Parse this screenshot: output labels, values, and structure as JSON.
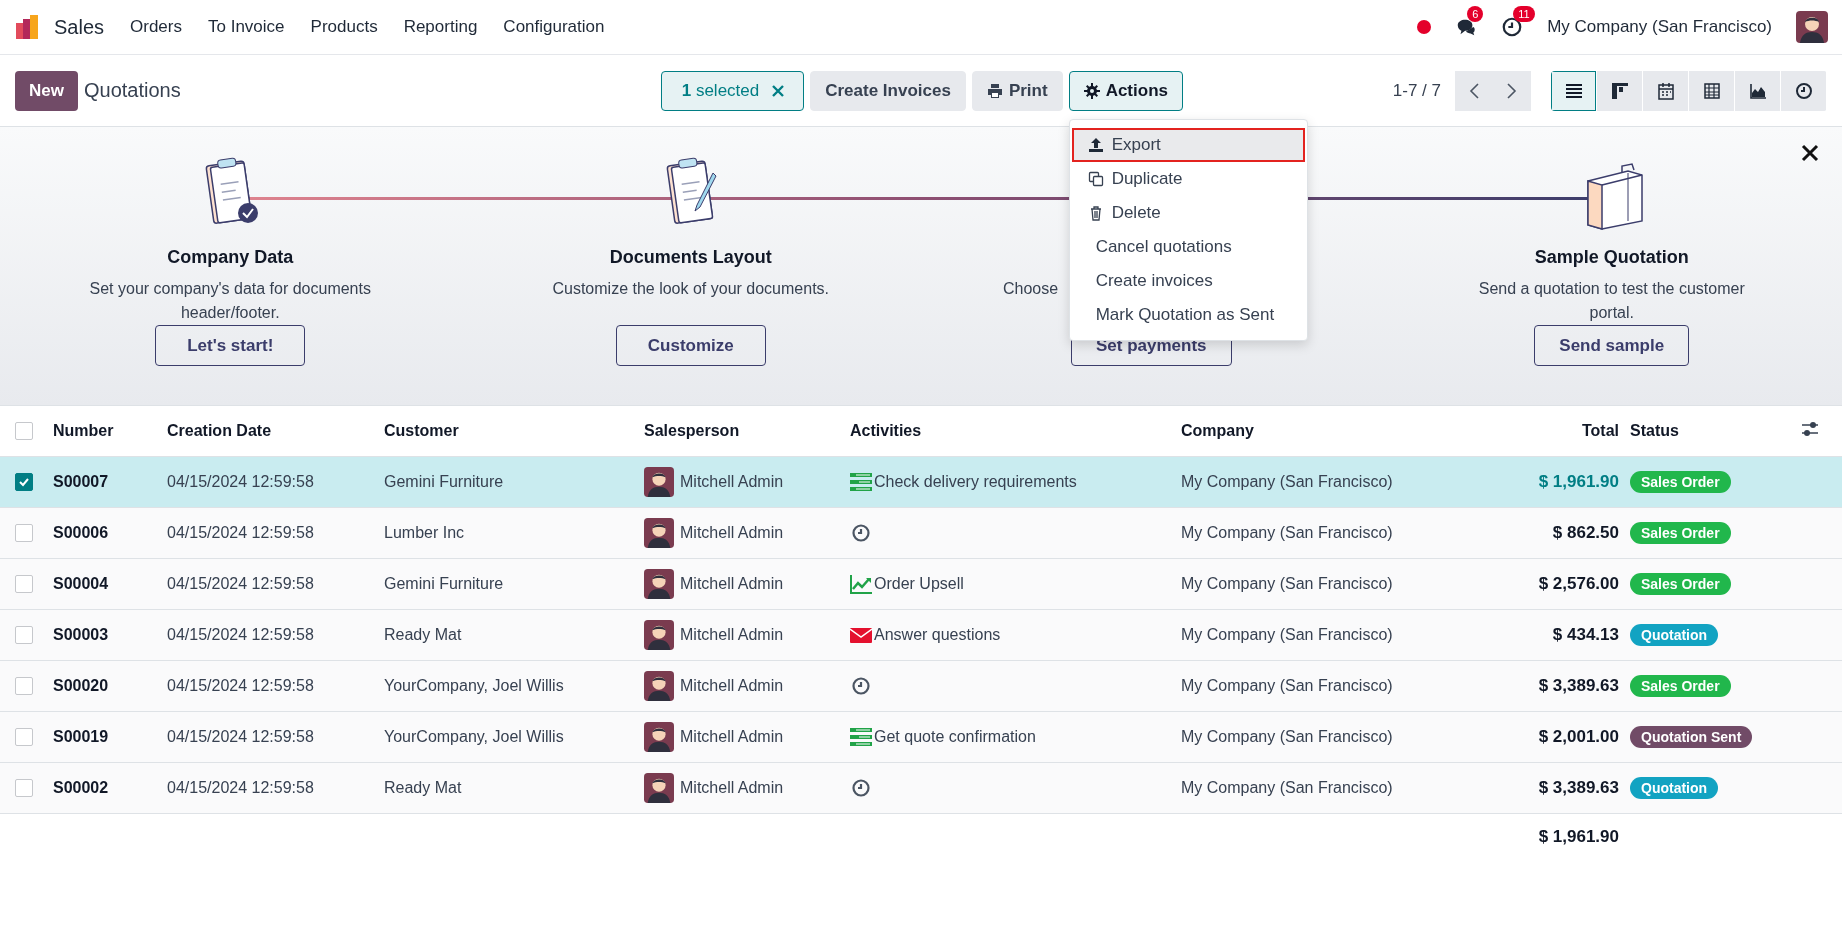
{
  "navbar": {
    "app": "Sales",
    "menu": [
      "Orders",
      "To Invoice",
      "Products",
      "Reporting",
      "Configuration"
    ],
    "messages_badge": "6",
    "activities_badge": "11",
    "company": "My Company (San Francisco)"
  },
  "control_panel": {
    "new_button": "New",
    "title": "Quotations",
    "selection": "**1** selected",
    "buttons": [
      {
        "label": "Create Invoices",
        "kind": "plain",
        "open": false
      },
      {
        "label": "Print",
        "kind": "print",
        "open": false
      },
      {
        "label": "Actions",
        "kind": "gear",
        "open": true
      }
    ],
    "pager": "1-7 / 7",
    "views": [
      {
        "kind": "list",
        "selected": true
      },
      {
        "kind": "kanban",
        "selected": false
      },
      {
        "kind": "calendar",
        "selected": false
      },
      {
        "kind": "pivot",
        "selected": false
      },
      {
        "kind": "graph",
        "selected": false
      },
      {
        "kind": "activity",
        "selected": false
      }
    ]
  },
  "actions_menu": [
    {
      "label": "Export",
      "kind": "upload",
      "highlighted": true,
      "marked": true
    },
    {
      "label": "Duplicate",
      "kind": "copy",
      "highlighted": false,
      "marked": false
    },
    {
      "label": "Delete",
      "kind": "trash",
      "highlighted": false,
      "marked": false
    },
    {
      "label": "Cancel quotations",
      "kind": "text",
      "highlighted": false,
      "marked": false
    },
    {
      "label": "Create invoices",
      "kind": "text",
      "highlighted": false,
      "marked": false
    },
    {
      "label": "Mark Quotation as Sent",
      "kind": "text",
      "highlighted": false,
      "marked": false
    }
  ],
  "onboarding": {
    "steps": [
      {
        "kind": "data",
        "title": "Company Data",
        "description": "Set your company's data for documents header/footer.",
        "button": "Let's start!",
        "covered": false
      },
      {
        "kind": "layout",
        "title": "Documents Layout",
        "description": "Customize the look of your documents.",
        "button": "Customize",
        "covered": false
      },
      {
        "kind": "payment",
        "description": "Choose",
        "button": "Set payments",
        "covered": true
      },
      {
        "kind": "sample",
        "title": "Sample Quotation",
        "description": "Send a quotation to test the customer portal.",
        "button": "Send sample",
        "covered": false
      }
    ]
  },
  "table": {
    "select_all": false,
    "columns": [
      "Number",
      "Creation Date",
      "Customer",
      "Salesperson",
      "Activities",
      "Company",
      "Total",
      "Status"
    ],
    "rows": [
      {
        "selected": true,
        "number": "S00007",
        "date": "04/15/2024 12:59:58",
        "customer": "Gemini Furniture",
        "salesperson": "Mitchell Admin",
        "activity": {
          "kind": "todo",
          "label": "Check delivery requirements"
        },
        "company": "My Company (San Francisco)",
        "total": "$ 1,961.90",
        "status": {
          "label": "Sales Order",
          "color": "#21b74c"
        }
      },
      {
        "selected": false,
        "number": "S00006",
        "date": "04/15/2024 12:59:58",
        "customer": "Lumber Inc",
        "salesperson": "Mitchell Admin",
        "activity": {
          "kind": "none"
        },
        "company": "My Company (San Francisco)",
        "total": "$ 862.50",
        "status": {
          "label": "Sales Order",
          "color": "#21b74c"
        }
      },
      {
        "selected": false,
        "number": "S00004",
        "date": "04/15/2024 12:59:58",
        "customer": "Gemini Furniture",
        "salesperson": "Mitchell Admin",
        "activity": {
          "kind": "upsell",
          "label": "Order Upsell"
        },
        "company": "My Company (San Francisco)",
        "total": "$ 2,576.00",
        "status": {
          "label": "Sales Order",
          "color": "#21b74c"
        }
      },
      {
        "selected": false,
        "number": "S00003",
        "date": "04/15/2024 12:59:58",
        "customer": "Ready Mat",
        "salesperson": "Mitchell Admin",
        "activity": {
          "kind": "email",
          "label": "Answer questions"
        },
        "company": "My Company (San Francisco)",
        "total": "$ 434.13",
        "status": {
          "label": "Quotation",
          "color": "#12a3c2"
        }
      },
      {
        "selected": false,
        "number": "S00020",
        "date": "04/15/2024 12:59:58",
        "customer": "YourCompany, Joel Willis",
        "salesperson": "Mitchell Admin",
        "activity": {
          "kind": "none"
        },
        "company": "My Company (San Francisco)",
        "total": "$ 3,389.63",
        "status": {
          "label": "Sales Order",
          "color": "#21b74c"
        }
      },
      {
        "selected": false,
        "number": "S00019",
        "date": "04/15/2024 12:59:58",
        "customer": "YourCompany, Joel Willis",
        "salesperson": "Mitchell Admin",
        "activity": {
          "kind": "todo",
          "label": "Get quote confirmation"
        },
        "company": "My Company (San Francisco)",
        "total": "$ 2,001.00",
        "status": {
          "label": "Quotation Sent",
          "color": "#714b67"
        }
      },
      {
        "selected": false,
        "number": "S00002",
        "date": "04/15/2024 12:59:58",
        "customer": "Ready Mat",
        "salesperson": "Mitchell Admin",
        "activity": {
          "kind": "none"
        },
        "company": "My Company (San Francisco)",
        "total": "$ 3,389.63",
        "status": {
          "label": "Quotation",
          "color": "#12a3c2"
        }
      }
    ],
    "total": "$ 1,961.90"
  }
}
